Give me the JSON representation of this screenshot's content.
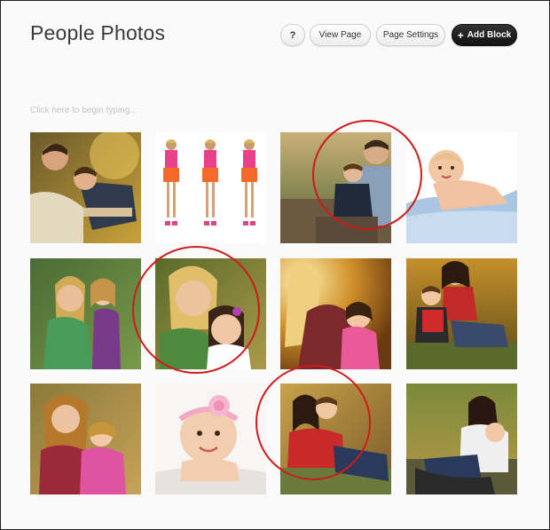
{
  "header": {
    "title": "People Photos",
    "help_label": "?",
    "view_page_label": "View Page",
    "page_settings_label": "Page Settings",
    "add_block_label": "Add Block",
    "add_block_icon": "plus-icon"
  },
  "editor": {
    "placeholder": "Click here to begin typing..."
  },
  "gallery": {
    "photos": [
      "father-and-son-photo",
      "girl-in-pink-dress-triple-photo",
      "father-hugging-son-photo",
      "baby-on-blanket-photo",
      "mother-hugging-daughter-photo",
      "mother-and-daughter-portrait-photo",
      "blonde-mother-and-girl-photo",
      "mother-and-son-on-grass-photo",
      "mother-and-daughter-autumn-photo",
      "baby-with-headband-photo",
      "mother-hugging-son-photo",
      "woman-and-child-park-photo"
    ],
    "highlighted_photos": [
      2,
      5,
      10
    ]
  },
  "colors": {
    "highlight_circle": "#d01a1a",
    "primary_button": "#111111",
    "background": "#fafafa"
  }
}
